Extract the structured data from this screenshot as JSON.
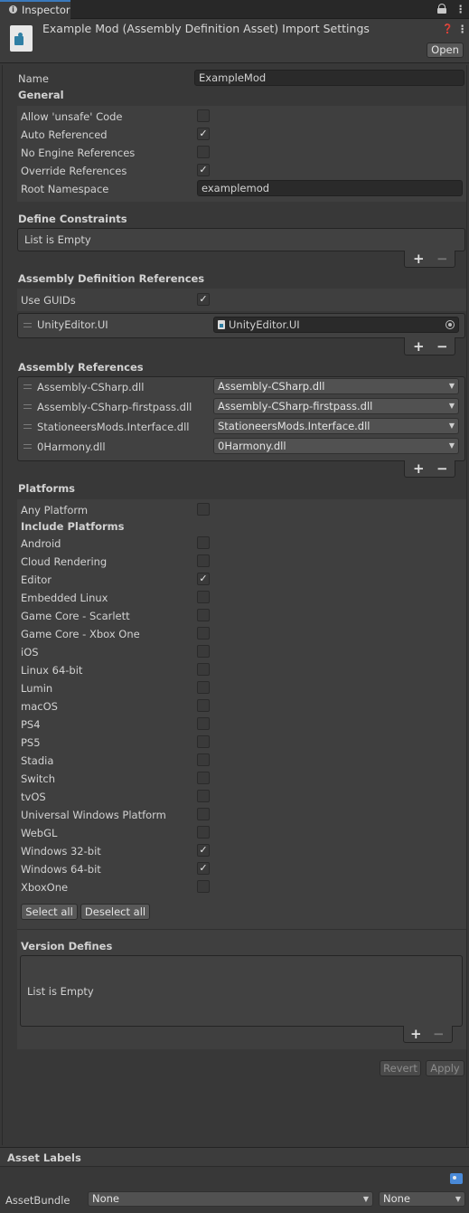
{
  "tab": {
    "title": "Inspector"
  },
  "header": {
    "title": "Example Mod (Assembly Definition Asset) Import Settings",
    "open_label": "Open",
    "help_glyph": "❓",
    "menu_glyph": "⋮"
  },
  "name_row": {
    "label": "Name",
    "value": "ExampleMod"
  },
  "general": {
    "heading": "General",
    "allow_unsafe": {
      "label": "Allow 'unsafe' Code",
      "checked": false
    },
    "auto_referenced": {
      "label": "Auto Referenced",
      "checked": true
    },
    "no_engine_refs": {
      "label": "No Engine References",
      "checked": false
    },
    "override_refs": {
      "label": "Override References",
      "checked": true
    },
    "root_namespace": {
      "label": "Root Namespace",
      "value": "examplemod"
    }
  },
  "define_constraints": {
    "heading": "Define Constraints",
    "empty_text": "List is Empty"
  },
  "asmdef_refs": {
    "heading": "Assembly Definition References",
    "use_guids": {
      "label": "Use GUIDs",
      "checked": true
    },
    "items": [
      {
        "name": "UnityEditor.UI",
        "value": "UnityEditor.UI"
      }
    ]
  },
  "assembly_refs": {
    "heading": "Assembly References",
    "items": [
      {
        "name": "Assembly-CSharp.dll",
        "value": "Assembly-CSharp.dll"
      },
      {
        "name": "Assembly-CSharp-firstpass.dll",
        "value": "Assembly-CSharp-firstpass.dll"
      },
      {
        "name": "StationeersMods.Interface.dll",
        "value": "StationeersMods.Interface.dll"
      },
      {
        "name": "0Harmony.dll",
        "value": "0Harmony.dll"
      }
    ]
  },
  "platforms": {
    "heading": "Platforms",
    "any_platform": {
      "label": "Any Platform",
      "checked": false
    },
    "include_heading": "Include Platforms",
    "items": [
      {
        "label": "Android",
        "checked": false
      },
      {
        "label": "Cloud Rendering",
        "checked": false
      },
      {
        "label": "Editor",
        "checked": true
      },
      {
        "label": "Embedded Linux",
        "checked": false
      },
      {
        "label": "Game Core - Scarlett",
        "checked": false
      },
      {
        "label": "Game Core - Xbox One",
        "checked": false
      },
      {
        "label": "iOS",
        "checked": false
      },
      {
        "label": "Linux 64-bit",
        "checked": false
      },
      {
        "label": "Lumin",
        "checked": false
      },
      {
        "label": "macOS",
        "checked": false
      },
      {
        "label": "PS4",
        "checked": false
      },
      {
        "label": "PS5",
        "checked": false
      },
      {
        "label": "Stadia",
        "checked": false
      },
      {
        "label": "Switch",
        "checked": false
      },
      {
        "label": "tvOS",
        "checked": false
      },
      {
        "label": "Universal Windows Platform",
        "checked": false
      },
      {
        "label": "WebGL",
        "checked": false
      },
      {
        "label": "Windows 32-bit",
        "checked": true
      },
      {
        "label": "Windows 64-bit",
        "checked": true
      },
      {
        "label": "XboxOne",
        "checked": false
      }
    ],
    "select_all": "Select all",
    "deselect_all": "Deselect all"
  },
  "version_defines": {
    "heading": "Version Defines",
    "empty_text": "List is Empty"
  },
  "actions": {
    "revert": "Revert",
    "apply": "Apply"
  },
  "asset_labels": {
    "heading": "Asset Labels",
    "assetbundle_label": "AssetBundle",
    "bundle_value": "None",
    "variant_value": "None"
  },
  "colors": {
    "background": "#383838",
    "panel": "#414141",
    "header": "#3c3c3c",
    "accent_tag": "#4a8ad8"
  }
}
